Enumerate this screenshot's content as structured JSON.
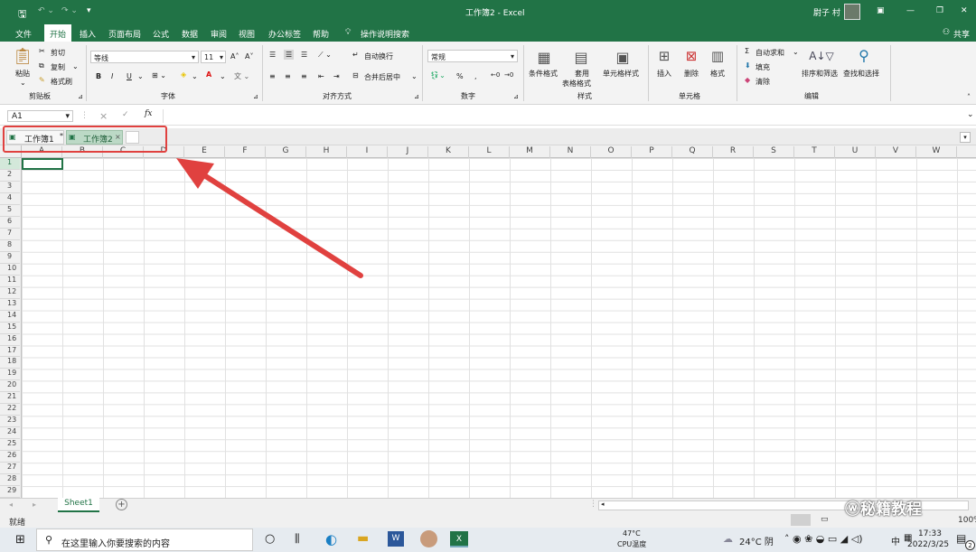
{
  "titlebar": {
    "window_title": "工作簿2 - Excel",
    "user": "尉子 村"
  },
  "menu": [
    "文件",
    "开始",
    "插入",
    "页面布局",
    "公式",
    "数据",
    "审阅",
    "视图",
    "办公标签",
    "帮助",
    "操作说明搜索"
  ],
  "share": "共享",
  "ribbon": {
    "paste": "粘贴",
    "cut": "剪切",
    "copy": "复制",
    "format_painter": "格式刷",
    "clipboard_group": "剪贴板",
    "font_name": "等线",
    "font_size": "11",
    "bold": "B",
    "italic": "I",
    "underline": "U",
    "font_group": "字体",
    "wrap_text": "自动换行",
    "merge_center": "合并后居中",
    "align_group": "对齐方式",
    "number_format": "常规",
    "percent": "%",
    "comma": ",",
    "number_group": "数字",
    "conditional_format": "条件格式",
    "table_format": "套用",
    "table_format2": "表格格式",
    "cell_style": "单元格样式",
    "styles_group": "样式",
    "insert": "插入",
    "delete": "删除",
    "format": "格式",
    "cells_group": "单元格",
    "autosum": "自动求和",
    "fill": "填充",
    "clear": "清除",
    "sort_filter": "排序和筛选",
    "find_select": "查找和选择",
    "edit_group": "编辑"
  },
  "formula_bar": {
    "name_box": "A1",
    "cancel": "×",
    "enter": "✓",
    "fx": "fx"
  },
  "workbook_tabs": [
    {
      "label": "工作簿1",
      "mark": "*"
    },
    {
      "label": "工作簿2",
      "mark": "×"
    }
  ],
  "columns": [
    "A",
    "B",
    "C",
    "D",
    "E",
    "F",
    "G",
    "H",
    "I",
    "J",
    "K",
    "L",
    "M",
    "N",
    "O",
    "P",
    "Q",
    "R",
    "S",
    "T",
    "U",
    "V",
    "W"
  ],
  "rows": [
    "1",
    "2",
    "3",
    "4",
    "5",
    "6",
    "7",
    "8",
    "9",
    "10",
    "11",
    "12",
    "13",
    "14",
    "15",
    "16",
    "17",
    "18",
    "19",
    "20",
    "21",
    "22",
    "23",
    "24",
    "25",
    "26",
    "27",
    "28",
    "29"
  ],
  "sheet_tab": "Sheet1",
  "status": "就绪",
  "zoom": "100%",
  "taskbar": {
    "search_placeholder": "在这里输入你要搜索的内容",
    "temp": "47°C",
    "cpu": "CPU温度",
    "weather": "24°C 阴",
    "ime": "中",
    "time": "17:33",
    "date": "2022/3/25",
    "notif": "2"
  },
  "watermark": "秘籍教程",
  "colors": {
    "excel_green": "#217346",
    "annotation": "#e0413f"
  }
}
